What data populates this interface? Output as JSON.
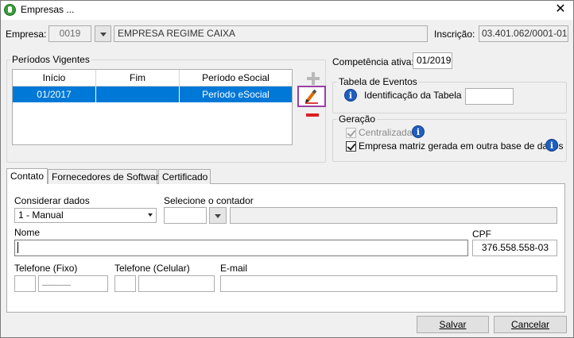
{
  "window": {
    "title": "Empresas ...",
    "close_glyph": "✕",
    "icon": "app-icon"
  },
  "empresa": {
    "label": "Empresa:",
    "code": "0019",
    "name": "EMPRESA REGIME CAIXA",
    "inscricao_label": "Inscrição:",
    "inscricao": "03.401.062/0001-01"
  },
  "periodos": {
    "title": "Períodos Vigentes",
    "columns": [
      "Início",
      "Fim",
      "Período eSocial"
    ],
    "rows": [
      {
        "inicio": "01/2017",
        "fim": "",
        "periodo": "Período eSocial"
      }
    ]
  },
  "competencia": {
    "label": "Competência ativa:",
    "value": "01/2019"
  },
  "tabela_eventos": {
    "title": "Tabela de Eventos",
    "id_label": "Identificação da Tabela",
    "id_value": ""
  },
  "geracao": {
    "title": "Geração",
    "centralizada_label": "Centralizada",
    "centralizada_checked": true,
    "matriz_label": "Empresa matriz gerada em outra base de dados",
    "matriz_checked": true
  },
  "tabs": [
    "Contato",
    "Fornecedores de Software",
    "Certificado"
  ],
  "contato": {
    "considerar_label": "Considerar dados",
    "considerar_value": "1 - Manual",
    "contador_label": "Selecione o contador",
    "contador_code": "",
    "contador_name": "",
    "nome_label": "Nome",
    "nome_value": "",
    "cpf_label": "CPF",
    "cpf_value": "376.558.558-03",
    "tel_fixo_label": "Telefone (Fixo)",
    "tel_fixo_ddd": "",
    "tel_fixo_num": "______",
    "tel_cel_label": "Telefone (Celular)",
    "tel_cel_ddd": "",
    "tel_cel_num": "",
    "email_label": "E-mail",
    "email_value": ""
  },
  "buttons": {
    "salvar": "Salvar",
    "cancelar": "Cancelar"
  },
  "colors": {
    "selection": "#0078d7",
    "highlight_border": "#9b3fa6",
    "remove": "#e01f1f"
  }
}
